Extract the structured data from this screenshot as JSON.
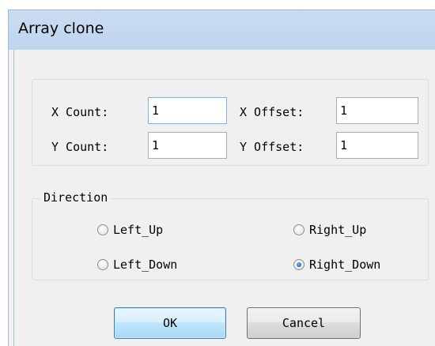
{
  "dialog": {
    "title": "Array clone"
  },
  "counts": {
    "x_count_label": "X Count:",
    "x_count_value": "1",
    "y_count_label": "Y Count:",
    "y_count_value": "1",
    "x_offset_label": "X Offset:",
    "x_offset_value": "1",
    "y_offset_label": "Y Offset:",
    "y_offset_value": "1"
  },
  "direction": {
    "legend": "Direction",
    "options": [
      {
        "label": "Left_Up",
        "checked": false
      },
      {
        "label": "Right_Up",
        "checked": false
      },
      {
        "label": "Left_Down",
        "checked": false
      },
      {
        "label": "Right_Down",
        "checked": true
      }
    ]
  },
  "buttons": {
    "ok_label": "OK",
    "cancel_label": "Cancel"
  },
  "colors": {
    "titlebar": "#c9dcf1",
    "dialog_bg": "#f0f0f0",
    "ok_border": "#3c7fb1",
    "radio_selected": "#1c64b8"
  }
}
